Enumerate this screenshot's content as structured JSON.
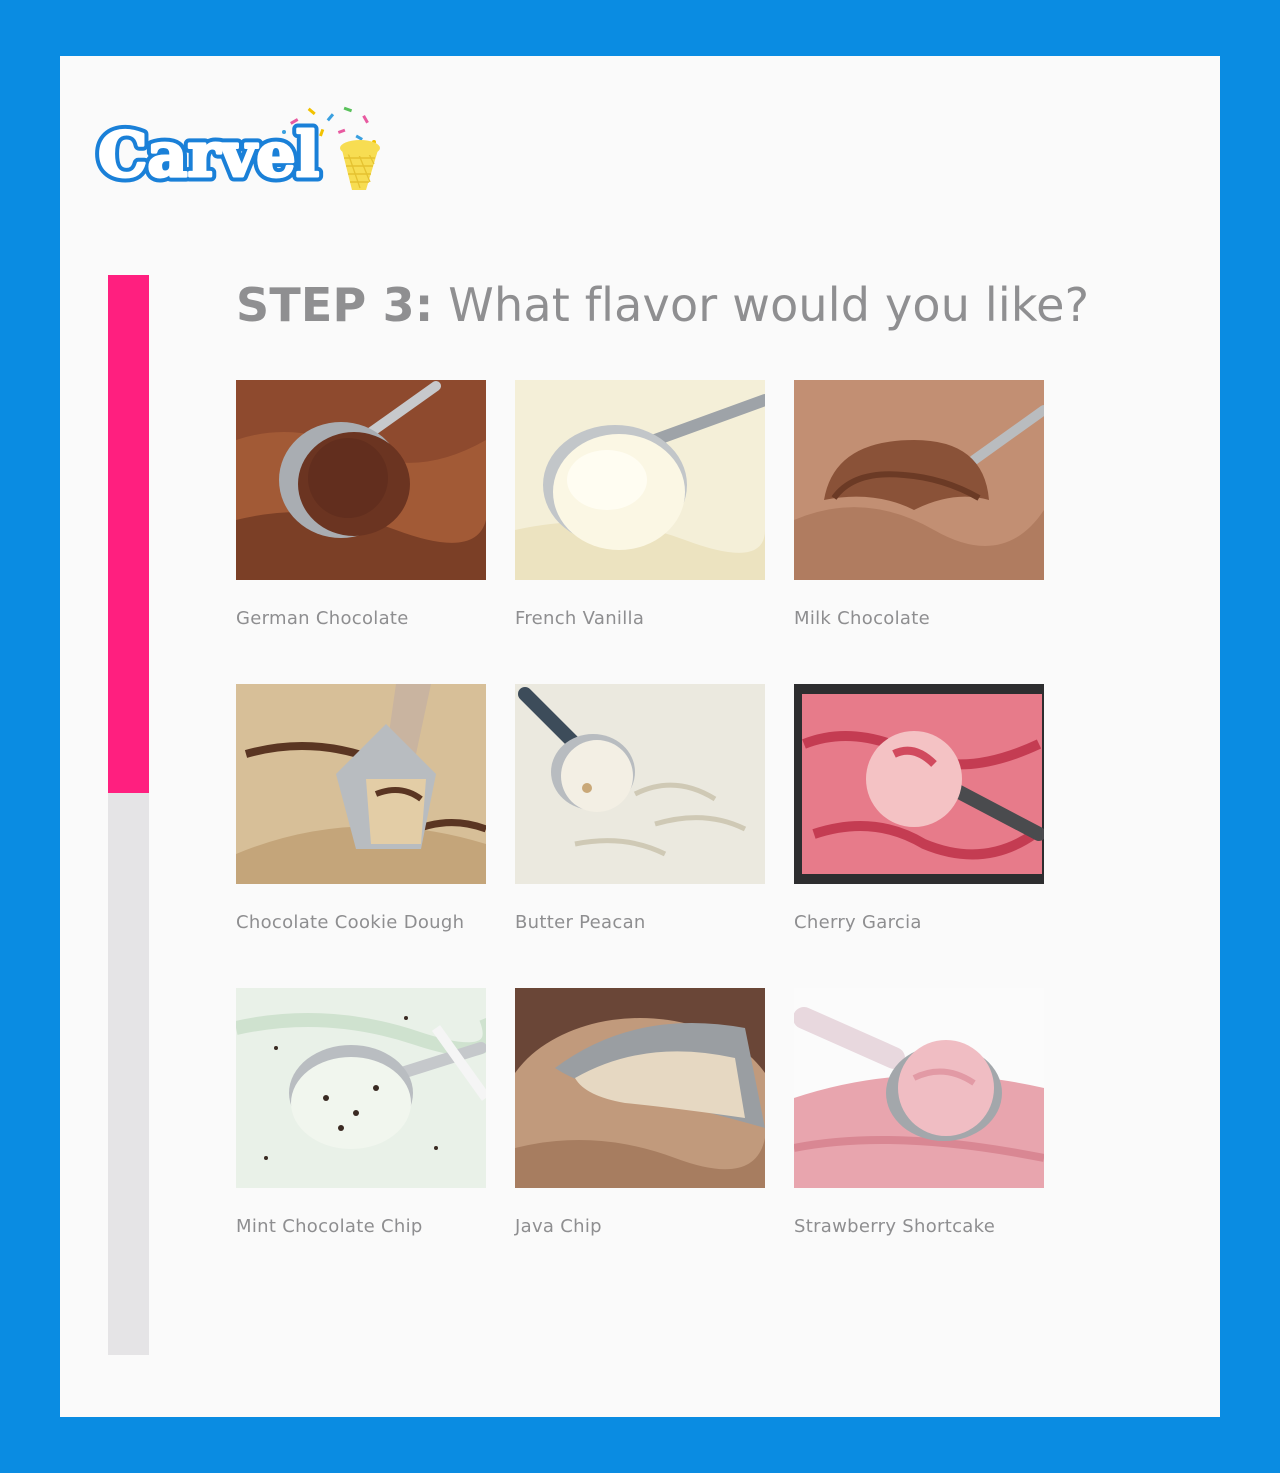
{
  "brand": {
    "name": "Carvel",
    "colors": {
      "logo_blue": "#1a80d8",
      "cone_yellow": "#f7dd52"
    }
  },
  "frame": {
    "background": "#0a8ce2",
    "card": "#fafafa"
  },
  "progress": {
    "percent": 48,
    "fill_color": "#ff1f7f",
    "track_color": "#e5e4e6"
  },
  "step": {
    "label": "STEP 3:",
    "question": "What flavor would you like?"
  },
  "flavors": [
    {
      "name": "German Chocolate",
      "icon": "ice-cream-scoop-photo"
    },
    {
      "name": "French Vanilla",
      "icon": "ice-cream-scoop-photo"
    },
    {
      "name": "Milk Chocolate",
      "icon": "ice-cream-scoop-photo"
    },
    {
      "name": "Chocolate Cookie Dough",
      "icon": "ice-cream-scoop-photo"
    },
    {
      "name": "Butter Peacan",
      "icon": "ice-cream-scoop-photo"
    },
    {
      "name": "Cherry Garcia",
      "icon": "ice-cream-scoop-photo"
    },
    {
      "name": "Mint Chocolate Chip",
      "icon": "ice-cream-scoop-photo"
    },
    {
      "name": "Java Chip",
      "icon": "ice-cream-scoop-photo"
    },
    {
      "name": "Strawberry Shortcake",
      "icon": "ice-cream-scoop-photo"
    }
  ]
}
